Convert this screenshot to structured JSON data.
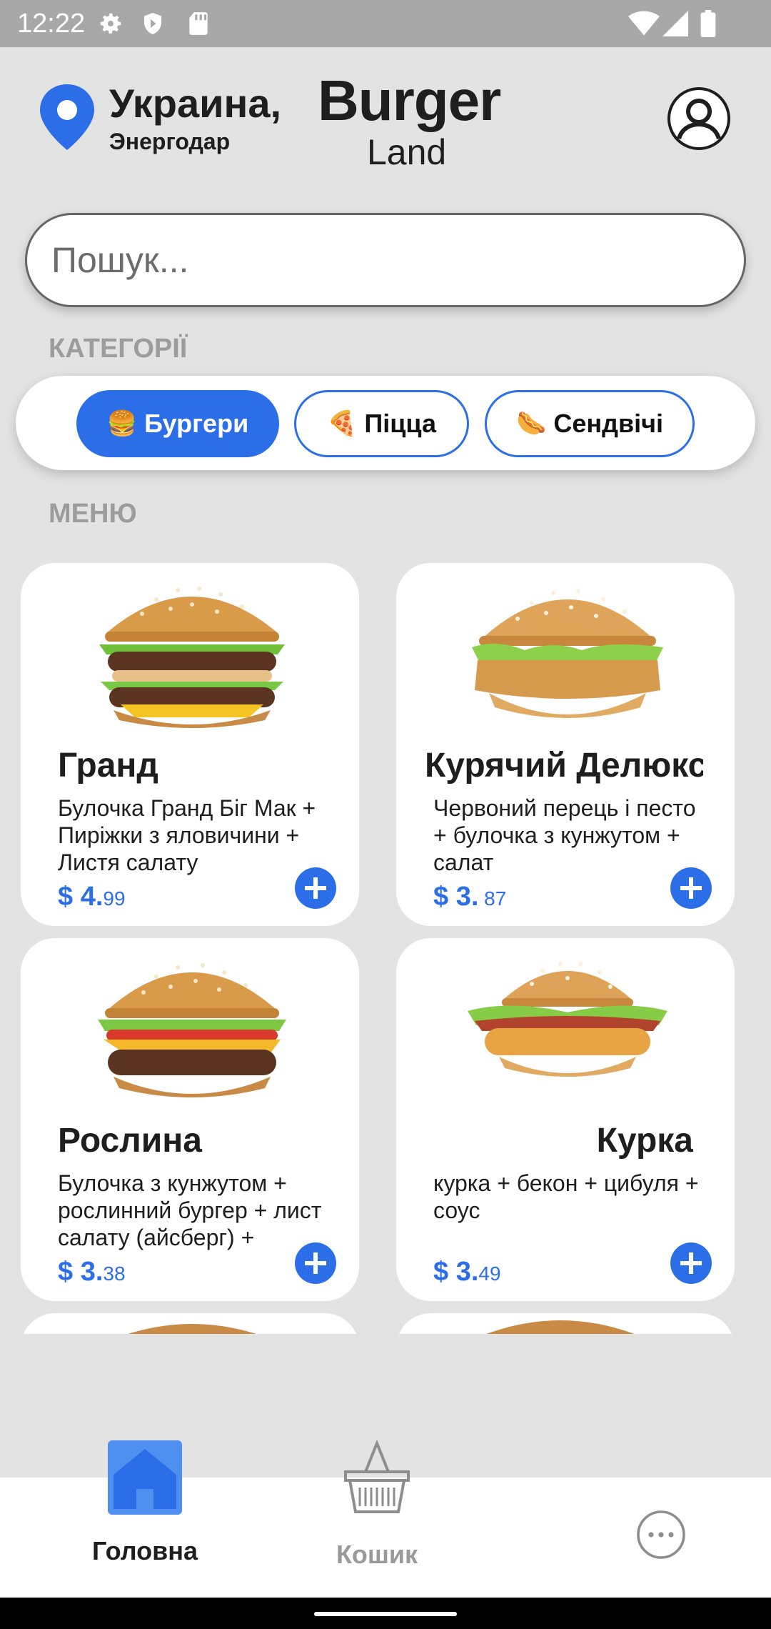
{
  "status_bar": {
    "time": "12:22",
    "icons": [
      "settings-icon",
      "shield-icon",
      "sd-card-icon",
      "wifi-icon",
      "signal-icon",
      "battery-icon"
    ]
  },
  "header": {
    "country": "Украина,",
    "city": "Энергодар",
    "brand_title": "Burger",
    "brand_subtitle": "Land",
    "icons": [
      "location-pin-icon",
      "profile-icon"
    ]
  },
  "search": {
    "placeholder": "Пошук..."
  },
  "categories": {
    "label": "КАТЕГОРІЇ",
    "items": [
      {
        "label": "Бургери",
        "emoji": "🍔",
        "active": true
      },
      {
        "label": "Піцца",
        "emoji": "🍕",
        "active": false
      },
      {
        "label": "Сендвічі",
        "emoji": "🌭",
        "active": false
      }
    ]
  },
  "menu": {
    "label": "МЕНЮ",
    "items": [
      {
        "name": "Гранд",
        "desc": "Булочка Гранд Біг Мак + Пиріжки з яловичини + Листя салату",
        "price_dollars": "$ 4.",
        "price_cents": "99"
      },
      {
        "name": "Курячий Делюкс",
        "desc": "Червоний перець і песто + булочка з кунжутом + салат",
        "price_dollars": "$ 3.",
        "price_cents": " 87"
      },
      {
        "name": "Рослина",
        "desc": "Булочка з кунжутом + рослинний бургер + лист салату (айсберг) +",
        "price_dollars": "$ 3.",
        "price_cents": "38"
      },
      {
        "name": "Курка",
        "desc": "курка + бекон + цибуля + соус",
        "price_dollars": "$ 3.",
        "price_cents": "49"
      }
    ]
  },
  "bottom_nav": {
    "items": [
      {
        "label": "Головна",
        "icon": "home-icon",
        "active": true
      },
      {
        "label": "Кошик",
        "icon": "basket-icon",
        "active": false
      },
      {
        "label": "",
        "icon": "more-icon",
        "active": false
      }
    ]
  },
  "colors": {
    "accent": "#2b6ee8",
    "background": "#e3e3e3",
    "muted_label": "#9c9c9c"
  }
}
